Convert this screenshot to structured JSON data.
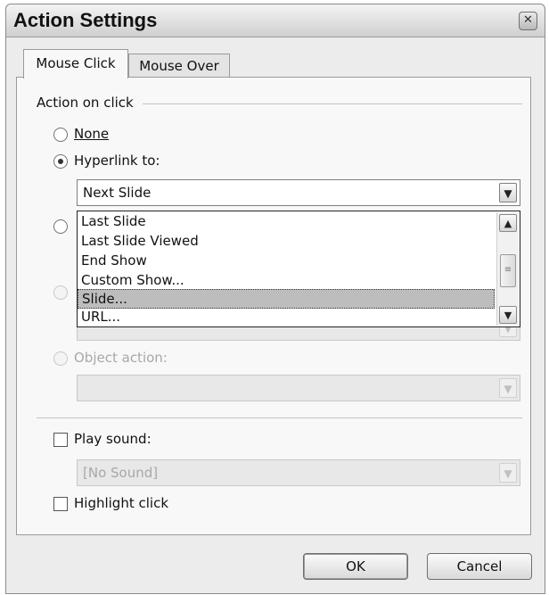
{
  "window": {
    "title": "Action Settings",
    "close_glyph": "✕"
  },
  "tabs": [
    {
      "label": "Mouse Click",
      "active": true
    },
    {
      "label": "Mouse Over",
      "active": false
    }
  ],
  "action_group": {
    "label": "Action on click"
  },
  "options": {
    "none": {
      "label": "None",
      "selected": false,
      "enabled": true
    },
    "hyperlink": {
      "label": "Hyperlink to:",
      "selected": true,
      "enabled": true,
      "value": "Next Slide"
    },
    "object_action": {
      "label": "Object action:",
      "enabled": false,
      "value": ""
    }
  },
  "hyperlink_dropdown": {
    "items": [
      "Last Slide",
      "Last Slide Viewed",
      "End Show",
      "Custom Show...",
      "Slide...",
      "URL..."
    ],
    "highlighted": "Slide..."
  },
  "sound": {
    "label": "Play sound:",
    "checked": false,
    "value": "[No Sound]",
    "enabled": false
  },
  "highlight": {
    "label": "Highlight click",
    "checked": false
  },
  "buttons": {
    "ok": "OK",
    "cancel": "Cancel"
  },
  "icons": [
    "close-icon",
    "chevron-down-icon",
    "scroll-up-icon",
    "scroll-down-icon",
    "scroll-grip-icon"
  ]
}
